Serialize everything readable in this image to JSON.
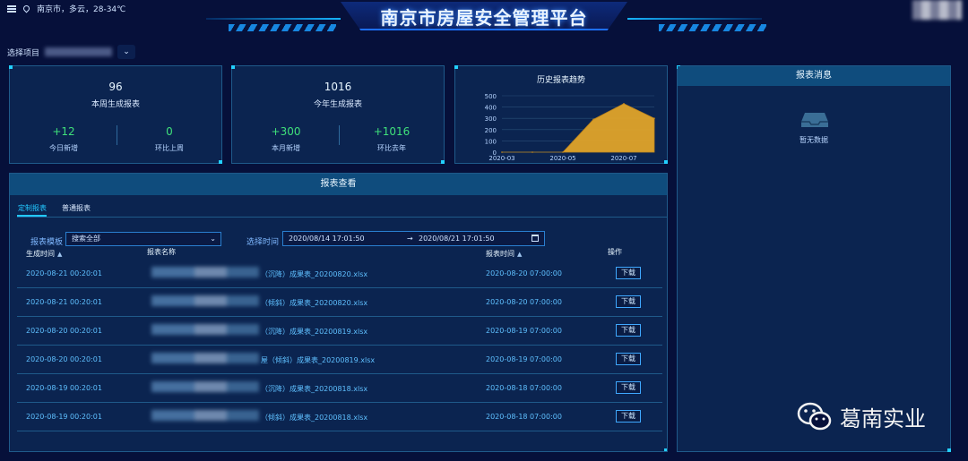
{
  "header": {
    "location": "南京市，多云，28-34℃",
    "title": "南京市房屋安全管理平台"
  },
  "project": {
    "label": "选择项目"
  },
  "stats": [
    {
      "value": "96",
      "label": "本周生成报表",
      "left": {
        "value": "+12",
        "label": "今日新增"
      },
      "right": {
        "value": "0",
        "label": "环比上周"
      }
    },
    {
      "value": "1016",
      "label": "今年生成报表",
      "left": {
        "value": "+300",
        "label": "本月新增"
      },
      "right": {
        "value": "+1016",
        "label": "环比去年"
      }
    }
  ],
  "chart_data": {
    "type": "area",
    "title": "历史报表趋势",
    "x": [
      "2020-03",
      "2020-04",
      "2020-05",
      "2020-06",
      "2020-07",
      "2020-08"
    ],
    "x_tick_labels": [
      "2020-03",
      "2020-05",
      "2020-07"
    ],
    "values": [
      0,
      0,
      0,
      290,
      430,
      300
    ],
    "ylim": [
      0,
      500
    ],
    "y_ticks": [
      0,
      100,
      200,
      300,
      400,
      500
    ],
    "color": "#e0a42a",
    "grid": true
  },
  "messages": {
    "title": "报表消息",
    "empty": "暂无数据"
  },
  "reports": {
    "title": "报表查看",
    "tabs": [
      "定制报表",
      "普通报表"
    ],
    "template_label": "报表模板",
    "template_value": "搜索全部",
    "time_label": "选择时间",
    "time_start": "2020/08/14 17:01:50",
    "time_sep": "→",
    "time_end": "2020/08/21 17:01:50",
    "columns": [
      "生成时间",
      "报表名称",
      "报表时间",
      "操作"
    ],
    "download_label": "下载",
    "rows": [
      {
        "created": "2020-08-21 00:20:01",
        "name": "（沉降）成果表_20200820.xlsx",
        "report_time": "2020-08-20 07:00:00"
      },
      {
        "created": "2020-08-21 00:20:01",
        "name": "（倾斜）成果表_20200820.xlsx",
        "report_time": "2020-08-20 07:00:00"
      },
      {
        "created": "2020-08-20 00:20:01",
        "name": "（沉降）成果表_20200819.xlsx",
        "report_time": "2020-08-19 07:00:00"
      },
      {
        "created": "2020-08-20 00:20:01",
        "name": "屋（倾斜）成果表_20200819.xlsx",
        "report_time": "2020-08-19 07:00:00"
      },
      {
        "created": "2020-08-19 00:20:01",
        "name": "（沉降）成果表_20200818.xlsx",
        "report_time": "2020-08-18 07:00:00"
      },
      {
        "created": "2020-08-19 00:20:01",
        "name": "（倾斜）成果表_20200818.xlsx",
        "report_time": "2020-08-18 07:00:00"
      }
    ]
  },
  "watermark": {
    "text": "葛南实业"
  }
}
